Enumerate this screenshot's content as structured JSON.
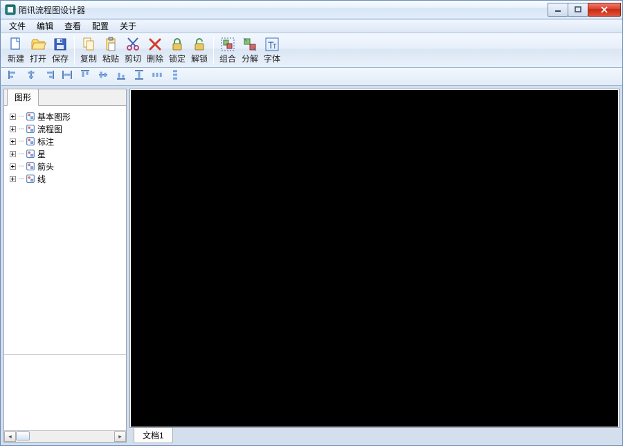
{
  "window": {
    "title": "陌讯流程图设计器"
  },
  "win_buttons": {
    "minimize": "minimize",
    "maximize": "maximize",
    "close": "close"
  },
  "menubar": [
    "文件",
    "编辑",
    "查看",
    "配置",
    "关于"
  ],
  "toolbar": {
    "groups": [
      [
        {
          "key": "new",
          "label": "新建",
          "icon": "doc-new"
        },
        {
          "key": "open",
          "label": "打开",
          "icon": "folder-open"
        },
        {
          "key": "save",
          "label": "保存",
          "icon": "floppy"
        }
      ],
      [
        {
          "key": "copy",
          "label": "复制",
          "icon": "copy"
        },
        {
          "key": "paste",
          "label": "粘贴",
          "icon": "paste"
        },
        {
          "key": "cut",
          "label": "剪切",
          "icon": "scissors"
        },
        {
          "key": "delete",
          "label": "删除",
          "icon": "delete-x"
        },
        {
          "key": "lock",
          "label": "锁定",
          "icon": "lock"
        },
        {
          "key": "unlock",
          "label": "解锁",
          "icon": "unlock"
        }
      ],
      [
        {
          "key": "group",
          "label": "组合",
          "icon": "group"
        },
        {
          "key": "ungroup",
          "label": "分解",
          "icon": "ungroup"
        },
        {
          "key": "font",
          "label": "字体",
          "icon": "font"
        }
      ]
    ]
  },
  "subtoolbar": [
    "align-left",
    "align-center-h",
    "align-right",
    "align-justify-h",
    "align-top",
    "align-middle-v",
    "align-bottom",
    "align-justify-v",
    "distribute-h",
    "distribute-v"
  ],
  "left_panel": {
    "tab_label": "图形",
    "tree": [
      {
        "label": "基本图形"
      },
      {
        "label": "流程图"
      },
      {
        "label": "标注"
      },
      {
        "label": "星"
      },
      {
        "label": "箭头"
      },
      {
        "label": "线"
      }
    ]
  },
  "document_tabs": [
    "文档1"
  ],
  "colors": {
    "canvas_bg": "#000000"
  }
}
